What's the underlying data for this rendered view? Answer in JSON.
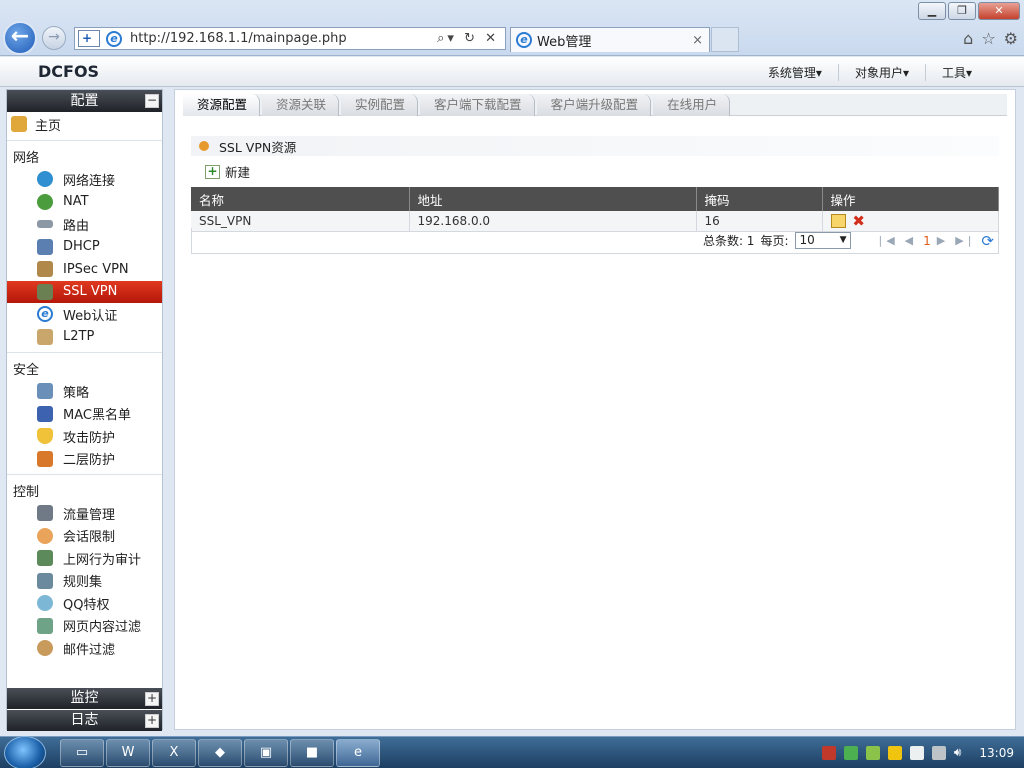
{
  "browser": {
    "url": "http://192.168.1.1/mainpage.php",
    "tab_title": "Web管理",
    "tab_close": "×"
  },
  "app": {
    "logo": "DCFOS",
    "top_menu": [
      "系统管理▾",
      "对象用户▾",
      "工具▾"
    ]
  },
  "sidebar": {
    "header": "配置",
    "collapse": "−",
    "home": "主页",
    "groups": [
      {
        "label": "网络",
        "items": [
          "网络连接",
          "NAT",
          "路由",
          "DHCP",
          "IPSec VPN",
          "SSL VPN",
          "Web认证",
          "L2TP"
        ]
      },
      {
        "label": "安全",
        "items": [
          "策略",
          "MAC黑名单",
          "攻击防护",
          "二层防护"
        ]
      },
      {
        "label": "控制",
        "items": [
          "流量管理",
          "会话限制",
          "上网行为审计",
          "规则集",
          "QQ特权",
          "网页内容过滤",
          "邮件过滤"
        ]
      }
    ],
    "selected": "SSL VPN",
    "footer": [
      {
        "label": "监控",
        "toggle": "+"
      },
      {
        "label": "日志",
        "toggle": "+"
      }
    ]
  },
  "content": {
    "tabs": [
      "资源配置",
      "资源关联",
      "实例配置",
      "客户端下载配置",
      "客户端升级配置",
      "在线用户"
    ],
    "active_tab": "资源配置",
    "section_title": "SSL VPN资源",
    "new_label": "新建",
    "columns": [
      "名称",
      "地址",
      "掩码",
      "操作"
    ],
    "rows": [
      {
        "name": "SSL_VPN",
        "address": "192.168.0.0",
        "mask": "16"
      }
    ],
    "pager": {
      "total_label": "总条数: 1",
      "per_page_label": "每页:",
      "per_page": "10",
      "page": "1"
    }
  },
  "taskbar": {
    "clock": "13:09"
  },
  "colors": {
    "selected": "#d42a14",
    "header_dark": "#2b2f35",
    "table_header": "#4f4f4f"
  }
}
